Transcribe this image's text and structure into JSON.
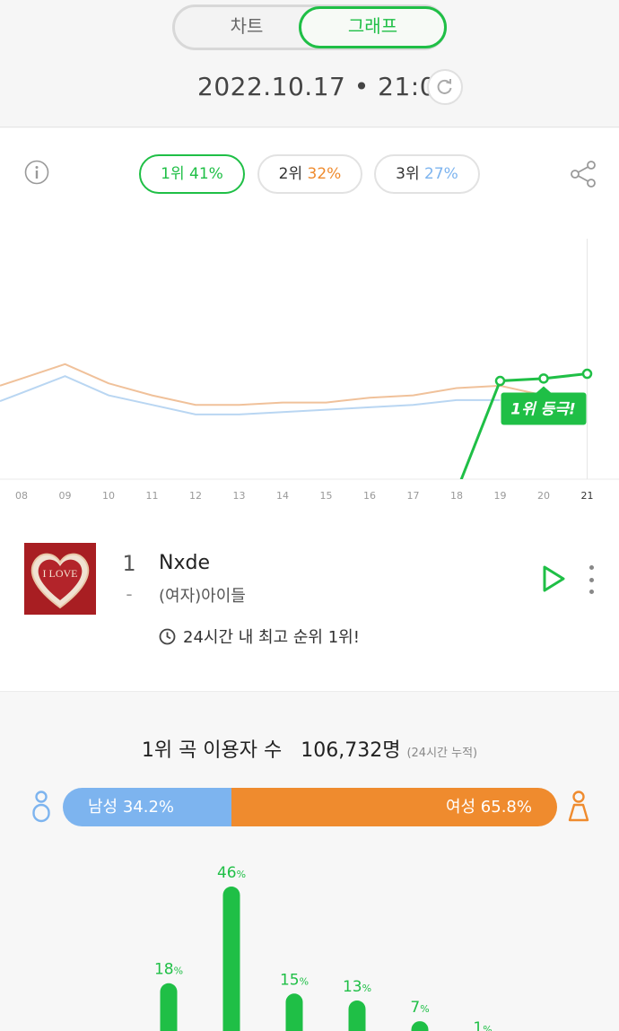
{
  "toggle": {
    "chart_label": "차트",
    "graph_label": "그래프",
    "selected": "그래프"
  },
  "header": {
    "datetime": "2022.10.17 • 21:00"
  },
  "rank_pills": [
    {
      "rank_label": "1위",
      "percent": "41%",
      "color": "#1fbf46"
    },
    {
      "rank_label": "2위",
      "percent": "32%",
      "color": "#ef8b2e"
    },
    {
      "rank_label": "3위",
      "percent": "27%",
      "color": "#7db4ef"
    }
  ],
  "chart_data": {
    "type": "line",
    "x": [
      "08",
      "09",
      "10",
      "11",
      "12",
      "13",
      "14",
      "15",
      "16",
      "17",
      "18",
      "19",
      "20",
      "21"
    ],
    "series": [
      {
        "color": "#1fbf46",
        "values": [
          null,
          null,
          null,
          null,
          null,
          null,
          null,
          null,
          null,
          null,
          -5,
          41,
          42,
          44
        ]
      },
      {
        "color": "#f0c19a",
        "values": [
          42,
          48,
          40,
          35,
          31,
          31,
          32,
          32,
          34,
          35,
          38,
          39,
          35,
          null
        ]
      },
      {
        "color": "#b9d6f2",
        "values": [
          36,
          43,
          35,
          31,
          27,
          27,
          28,
          29,
          30,
          31,
          33,
          33,
          null,
          null
        ]
      }
    ],
    "ylim": [
      0,
      100
    ],
    "annotation": "1위 등극!",
    "accent_colors": {
      "green": "#1fbf46",
      "orange": "#ef8b2e",
      "blue": "#7db4ef"
    }
  },
  "song": {
    "rank": "1",
    "change": "-",
    "title": "Nxde",
    "artist": "(여자)아이들",
    "album_art_text": "I LOVE",
    "best_rank_text": "24시간 내 최고 순위 1위!"
  },
  "listeners": {
    "label": "1위 곡 이용자 수",
    "count": "106,732명",
    "note": "(24시간 누적)"
  },
  "gender": {
    "male_label": "남성 34.2%",
    "female_label": "여성 65.8%",
    "male_fraction": 0.342
  },
  "age_chart": {
    "values": [
      18,
      46,
      15,
      13,
      7,
      1
    ],
    "labels": [
      "18",
      "46",
      "15",
      "13",
      "7",
      "1"
    ],
    "unit": "%",
    "color": "#1fbf46"
  }
}
